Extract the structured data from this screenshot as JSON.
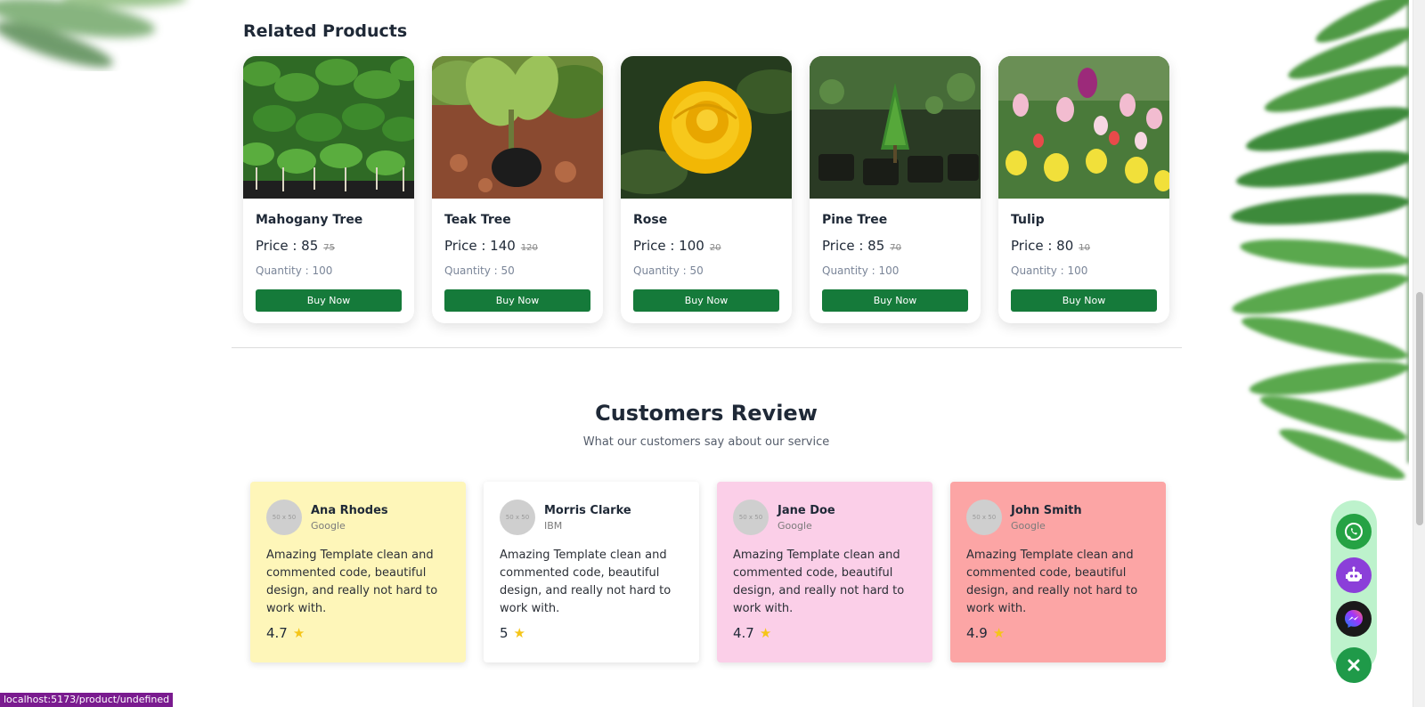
{
  "related": {
    "title": "Related Products",
    "buy_label": "Buy Now",
    "products": [
      {
        "name": "Mahogany Tree",
        "price": "Price : 85",
        "old_price": "75",
        "quantity": "Quantity : 100",
        "image": "mahogany-saplings"
      },
      {
        "name": "Teak Tree",
        "price": "Price : 140",
        "old_price": "120",
        "quantity": "Quantity : 50",
        "image": "teak-sapling"
      },
      {
        "name": "Rose",
        "price": "Price : 100",
        "old_price": "20",
        "quantity": "Quantity : 50",
        "image": "yellow-rose"
      },
      {
        "name": "Pine Tree",
        "price": "Price : 85",
        "old_price": "70",
        "quantity": "Quantity : 100",
        "image": "pine-seedling"
      },
      {
        "name": "Tulip",
        "price": "Price : 80",
        "old_price": "10",
        "quantity": "Quantity : 100",
        "image": "tulip-field"
      }
    ]
  },
  "reviews": {
    "title": "Customers Review",
    "subtitle": "What our customers say about our service",
    "avatar_placeholder": "50 x 50",
    "items": [
      {
        "name": "Ana Rhodes",
        "company": "Google",
        "text": "Amazing Template clean and commented code, beautiful design, and really not hard to work with.",
        "rating": "4.7",
        "bg": "#fef6b9"
      },
      {
        "name": "Morris Clarke",
        "company": "IBM",
        "text": "Amazing Template clean and commented code, beautiful design, and really not hard to work with.",
        "rating": "5",
        "bg": "#ffffff"
      },
      {
        "name": "Jane Doe",
        "company": "Google",
        "text": "Amazing Template clean and commented code, beautiful design, and really not hard to work with.",
        "rating": "4.7",
        "bg": "#fbcfe8"
      },
      {
        "name": "John Smith",
        "company": "Google",
        "text": "Amazing Template clean and commented code, beautiful design, and really not hard to work with.",
        "rating": "4.9",
        "bg": "#fca5a5"
      }
    ]
  },
  "fabs": [
    {
      "icon": "whatsapp-icon",
      "color": "#25a244"
    },
    {
      "icon": "robot-icon",
      "color": "#8b3fd9"
    },
    {
      "icon": "messenger-icon",
      "color": "#1a1a1a"
    },
    {
      "icon": "close-icon",
      "color": "#1f9a49"
    }
  ],
  "status_bar": "localhost:5173/product/undefined",
  "colors": {
    "accent": "#157a3a",
    "star": "#f5c518"
  }
}
